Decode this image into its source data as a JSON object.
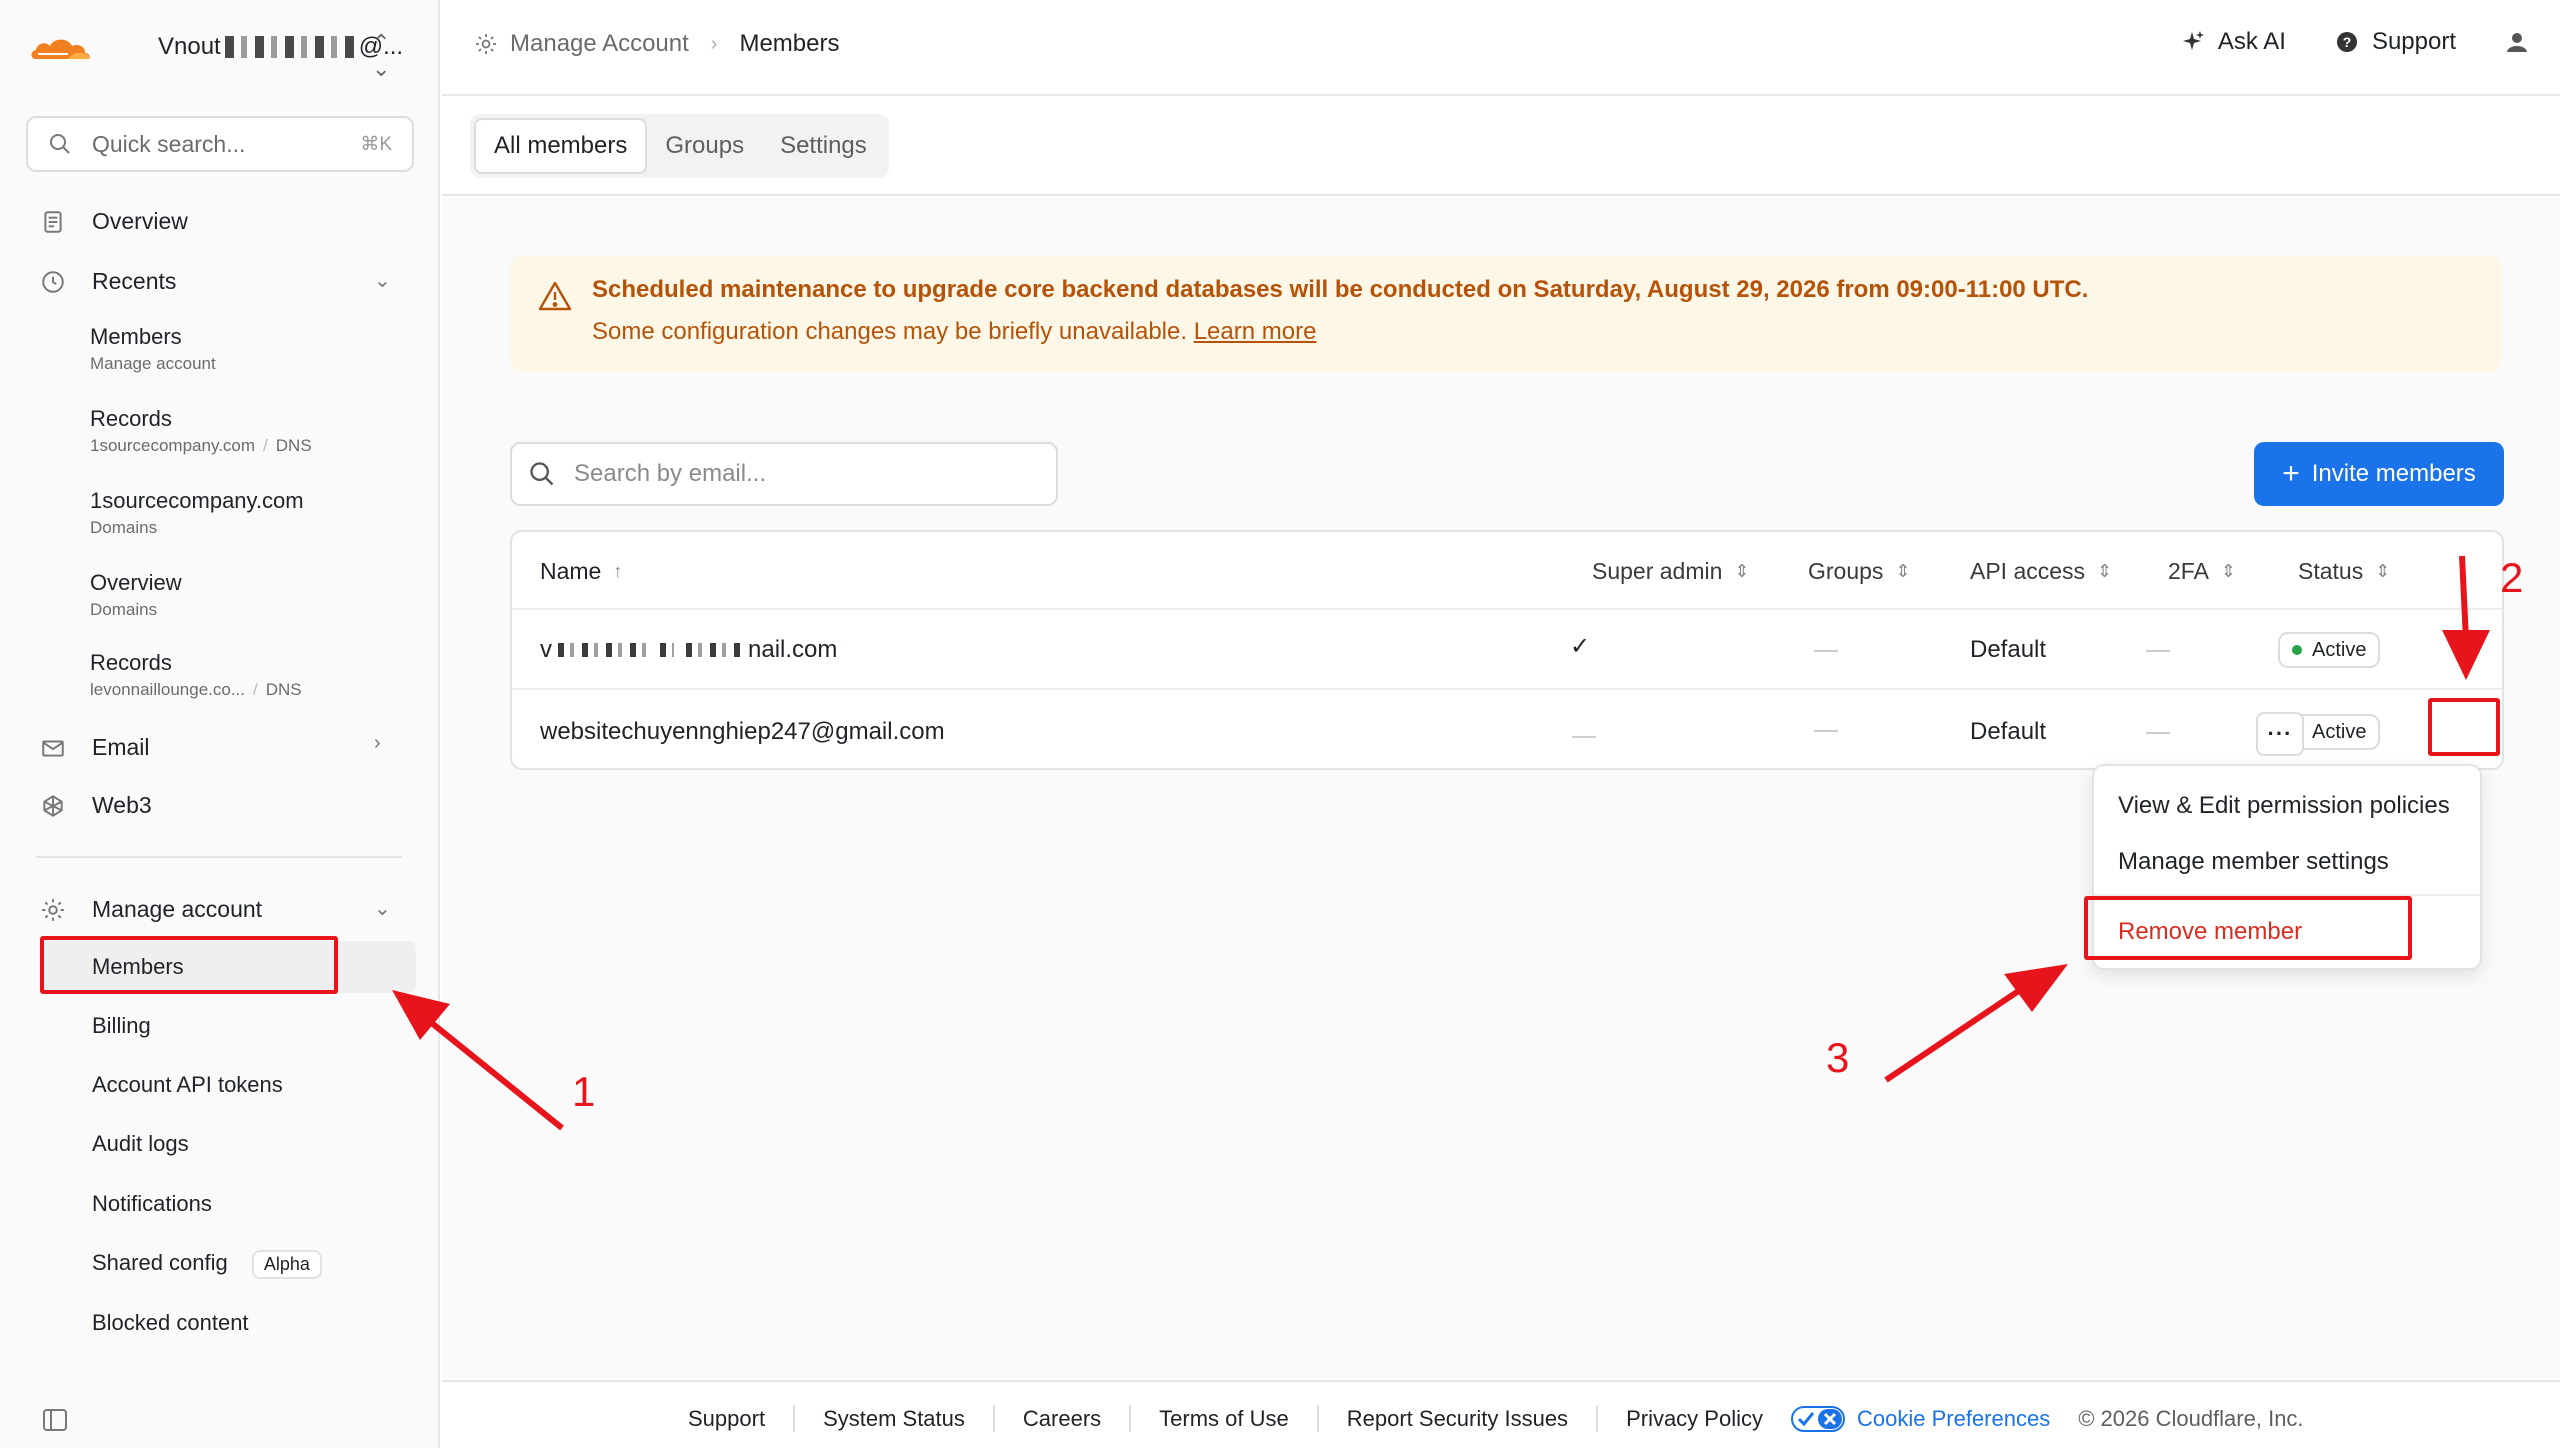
{
  "account": {
    "name_prefix": "Vnout",
    "name_suffix": "@...",
    "switch_icon": "chevron-up-down-icon",
    "brand_color": "#f38020"
  },
  "search": {
    "placeholder": "Quick search...",
    "shortcut": "⌘K"
  },
  "sidebar": {
    "overview": "Overview",
    "recents": "Recents",
    "recent_items": [
      {
        "title": "Members",
        "sub": "Manage account",
        "sub2": ""
      },
      {
        "title": "Records",
        "sub": "1sourcecompany.com",
        "sub2": "DNS"
      },
      {
        "title": "1sourcecompany.com",
        "sub": "Domains",
        "sub2": ""
      },
      {
        "title": "Overview",
        "sub": "Domains",
        "sub2": ""
      },
      {
        "title": "Records",
        "sub": "levonnaillounge.co...",
        "sub2": "DNS"
      }
    ],
    "email": "Email",
    "web3": "Web3",
    "manage_account": "Manage account",
    "manage_items": {
      "members": "Members",
      "billing": "Billing",
      "api_tokens": "Account API tokens",
      "audit_logs": "Audit logs",
      "notifications": "Notifications",
      "shared_config": "Shared config",
      "shared_config_badge": "Alpha",
      "blocked_content": "Blocked content"
    }
  },
  "header": {
    "breadcrumb_parent": "Manage Account",
    "breadcrumb_current": "Members",
    "ask_ai": "Ask AI",
    "support": "Support"
  },
  "tabs": [
    {
      "label": "All members",
      "active": true
    },
    {
      "label": "Groups",
      "active": false
    },
    {
      "label": "Settings",
      "active": false
    }
  ],
  "banner": {
    "title": "Scheduled maintenance to upgrade core backend databases will be conducted on Saturday, August 29, 2026 from 09:00-11:00 UTC.",
    "body": "Some configuration changes may be briefly unavailable.",
    "link": "Learn more",
    "color": "#b45309",
    "bg": "#fdf7e8"
  },
  "members": {
    "search_placeholder": "Search by email...",
    "invite_label": "Invite members",
    "invite_color": "#1a73e8",
    "columns": {
      "name": "Name",
      "super_admin": "Super admin",
      "groups": "Groups",
      "api_access": "API access",
      "twofa": "2FA",
      "status": "Status"
    },
    "rows": [
      {
        "email_prefix": "v",
        "email_suffix": "nail.com",
        "super_admin": "✓",
        "api_access": "Default",
        "status": "Active"
      },
      {
        "email": "websitechuyennghiep247@gmail.com",
        "api_access": "Default",
        "status": "Active"
      }
    ],
    "more_label": "···"
  },
  "context_menu": {
    "items": [
      "View & Edit permission policies",
      "Manage member settings",
      "Remove member"
    ],
    "danger_color": "#d92d20"
  },
  "annotations": {
    "labels": [
      "1",
      "2",
      "3"
    ],
    "color": "#e8141b"
  },
  "footer": {
    "links": [
      "Support",
      "System Status",
      "Careers",
      "Terms of Use",
      "Report Security Issues",
      "Privacy Policy"
    ],
    "cookie": "Cookie Preferences",
    "copyright": "© 2026 Cloudflare, Inc."
  }
}
